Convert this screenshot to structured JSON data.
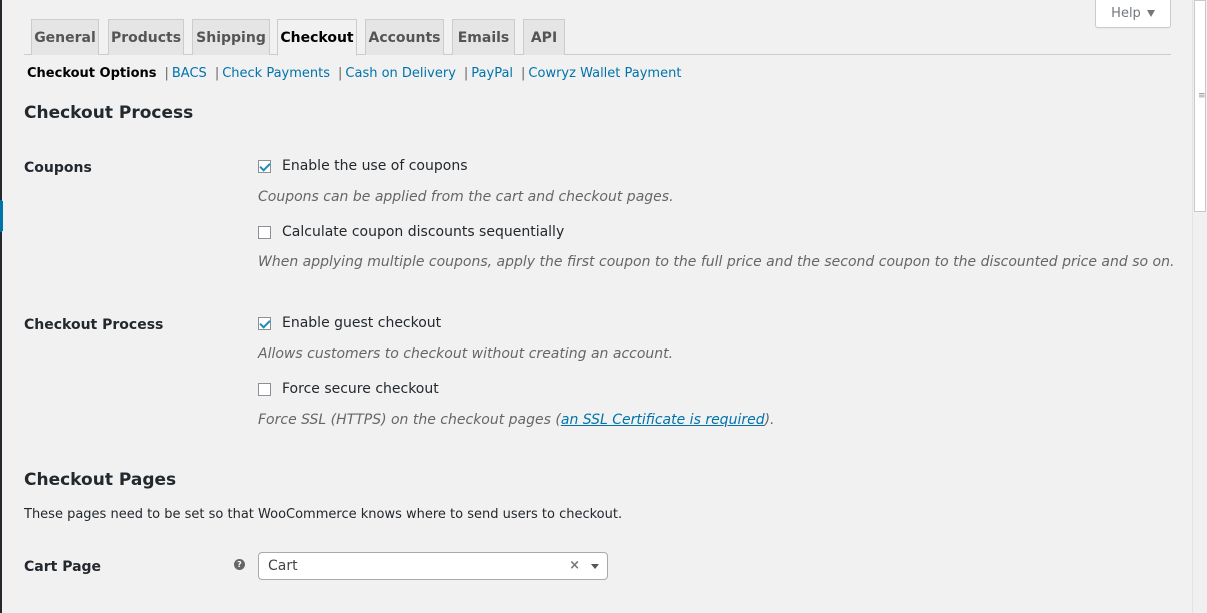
{
  "help": {
    "label": "Help"
  },
  "tabs": [
    {
      "label": "General"
    },
    {
      "label": "Products"
    },
    {
      "label": "Shipping"
    },
    {
      "label": "Checkout",
      "active": true
    },
    {
      "label": "Accounts"
    },
    {
      "label": "Emails"
    },
    {
      "label": "API"
    }
  ],
  "subnav": {
    "current": "Checkout Options",
    "separator": "|",
    "links": [
      "BACS",
      "Check Payments",
      "Cash on Delivery",
      "PayPal",
      "Cowryz Wallet Payment"
    ]
  },
  "section1": {
    "title": "Checkout Process"
  },
  "coupons": {
    "label": "Coupons",
    "opt1": {
      "label": "Enable the use of coupons",
      "checked": true
    },
    "desc1": "Coupons can be applied from the cart and checkout pages.",
    "opt2": {
      "label": "Calculate coupon discounts sequentially",
      "checked": false
    },
    "desc2": "When applying multiple coupons, apply the first coupon to the full price and the second coupon to the discounted price and so on."
  },
  "process": {
    "label": "Checkout Process",
    "opt1": {
      "label": "Enable guest checkout",
      "checked": true
    },
    "desc1": "Allows customers to checkout without creating an account.",
    "opt2": {
      "label": "Force secure checkout",
      "checked": false
    },
    "desc2_prefix": "Force SSL (HTTPS) on the checkout pages (",
    "desc2_link": "an SSL Certificate is required",
    "desc2_suffix": ")."
  },
  "section2": {
    "title": "Checkout Pages",
    "description": "These pages need to be set so that WooCommerce knows where to send users to checkout."
  },
  "cart_page": {
    "label": "Cart Page",
    "help_glyph": "?",
    "value": "Cart",
    "clear_glyph": "×"
  },
  "colors": {
    "accent": "#0073aa",
    "checkmark": "#1e8cbe",
    "background": "#f1f1f1"
  }
}
